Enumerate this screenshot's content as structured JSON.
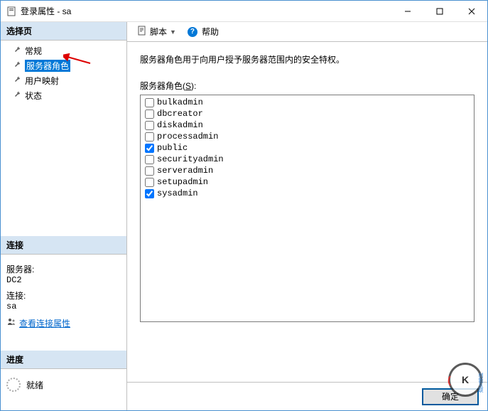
{
  "window": {
    "title": "登录属性 - sa"
  },
  "sidebar": {
    "select_page_header": "选择页",
    "nav": [
      {
        "label": "常规",
        "selected": false
      },
      {
        "label": "服务器角色",
        "selected": true
      },
      {
        "label": "用户映射",
        "selected": false
      },
      {
        "label": "状态",
        "selected": false
      }
    ],
    "connection_header": "连接",
    "server_label": "服务器:",
    "server_value": "DC2",
    "conn_label": "连接:",
    "conn_value": "sa",
    "view_props_link": "查看连接属性",
    "progress_header": "进度",
    "progress_status": "就绪"
  },
  "toolbar": {
    "script_label": "脚本",
    "help_label": "帮助"
  },
  "main": {
    "description": "服务器角色用于向用户授予服务器范围内的安全特权。",
    "roles_label_prefix": "服务器角色(",
    "roles_mnemonic": "S",
    "roles_label_suffix": "):",
    "roles": [
      {
        "name": "bulkadmin",
        "checked": false
      },
      {
        "name": "dbcreator",
        "checked": false
      },
      {
        "name": "diskadmin",
        "checked": false
      },
      {
        "name": "processadmin",
        "checked": false
      },
      {
        "name": "public",
        "checked": true
      },
      {
        "name": "securityadmin",
        "checked": false
      },
      {
        "name": "serveradmin",
        "checked": false
      },
      {
        "name": "setupadmin",
        "checked": false
      },
      {
        "name": "sysadmin",
        "checked": true
      }
    ]
  },
  "footer": {
    "ok_label": "确定"
  },
  "watermark": {
    "text": "创新互联"
  }
}
